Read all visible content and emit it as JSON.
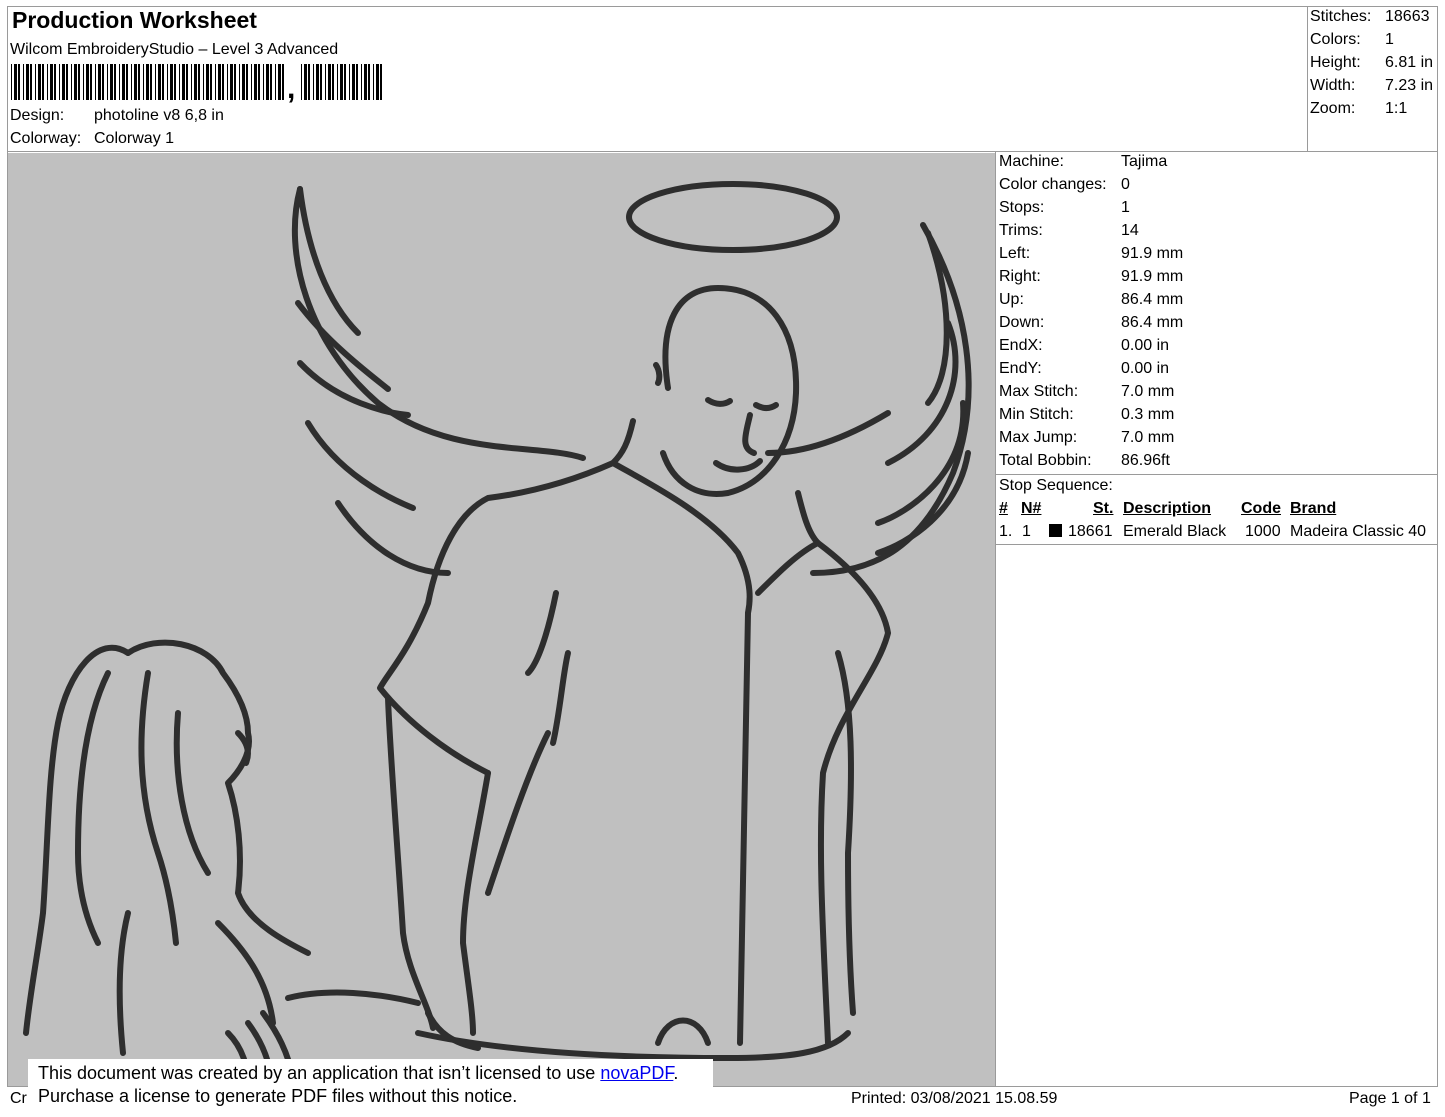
{
  "header": {
    "title": "Production Worksheet",
    "software": "Wilcom EmbroideryStudio – Level 3 Advanced",
    "barcode_suffix": ",",
    "design_label": "Design:",
    "design_value": "photoline v8 6,8 in",
    "colorway_label": "Colorway:",
    "colorway_value": "Colorway 1"
  },
  "stats": [
    {
      "label": "Stitches:",
      "value": "18663"
    },
    {
      "label": "Colors:",
      "value": "1"
    },
    {
      "label": "Height:",
      "value": "6.81 in"
    },
    {
      "label": "Width:",
      "value": "7.23 in"
    },
    {
      "label": "Zoom:",
      "value": "1:1"
    }
  ],
  "machine_info": [
    {
      "label": "Machine:",
      "value": "Tajima"
    },
    {
      "label": "Color changes:",
      "value": "0"
    },
    {
      "label": "Stops:",
      "value": "1"
    },
    {
      "label": "Trims:",
      "value": "14"
    },
    {
      "label": "Left:",
      "value": "91.9 mm"
    },
    {
      "label": "Right:",
      "value": "91.9 mm"
    },
    {
      "label": "Up:",
      "value": "86.4 mm"
    },
    {
      "label": "Down:",
      "value": "86.4 mm"
    },
    {
      "label": "EndX:",
      "value": "0.00 in"
    },
    {
      "label": "EndY:",
      "value": "0.00 in"
    },
    {
      "label": "Max Stitch:",
      "value": "7.0 mm"
    },
    {
      "label": "Min Stitch:",
      "value": "0.3 mm"
    },
    {
      "label": "Max Jump:",
      "value": "7.0 mm"
    },
    {
      "label": "Total Bobbin:",
      "value": "86.96ft"
    }
  ],
  "stop_sequence": {
    "title": "Stop Sequence:",
    "headers": {
      "num": "#",
      "needle": "N#",
      "stitches": "St.",
      "description": "Description",
      "code": "Code",
      "brand": "Brand"
    },
    "rows": [
      {
        "num": "1.",
        "needle": "1",
        "swatch_color": "#000000",
        "stitches": "18661",
        "description": "Emerald Black",
        "code": "1000",
        "brand": "Madeira Classic 40"
      }
    ]
  },
  "design_colors": {
    "background": "#c0c0c0",
    "thread": "#2e2e2e"
  },
  "notice": {
    "line1_prefix": "This document was created by an application that isn’t licensed to use ",
    "link_text": "novaPDF",
    "line1_suffix": ".",
    "line2": "Purchase a license to generate PDF files without this notice."
  },
  "footer": {
    "left_text": "Cr",
    "printed": "Printed: 03/08/2021 15.08.59",
    "page": "Page 1 of 1"
  }
}
